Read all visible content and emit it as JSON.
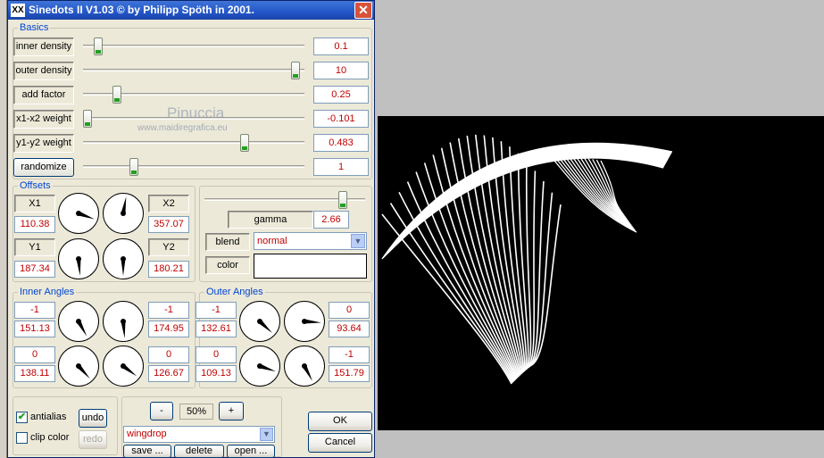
{
  "title": "Sinedots II V1.03 © by Philipp Spöth in 2001.",
  "title_icon": "XX",
  "close_glyph": "✕",
  "watermark": {
    "line1": "Pinuccia",
    "line2": "www.maidiregrafica.eu"
  },
  "basics": {
    "title": "Basics",
    "rows": [
      {
        "label": "inner density",
        "value": "0.1",
        "slider": 0.05
      },
      {
        "label": "outer density",
        "value": "10",
        "slider": 0.98
      },
      {
        "label": "add factor",
        "value": "0.25",
        "slider": 0.14
      },
      {
        "label": "x1-x2 weight",
        "value": "-0.101",
        "slider": 0.0
      },
      {
        "label": "y1-y2 weight",
        "value": "0.483",
        "slider": 0.74
      },
      {
        "label": "randomize",
        "value": "1",
        "slider": 0.22
      }
    ]
  },
  "offsets": {
    "title": "Offsets",
    "x1": {
      "label": "X1",
      "value": "110.38"
    },
    "x2": {
      "label": "X2",
      "value": "357.07"
    },
    "y1": {
      "label": "Y1",
      "value": "187.34"
    },
    "y2": {
      "label": "Y2",
      "value": "180.21"
    },
    "dial_angles": [
      110,
      10,
      175,
      180
    ]
  },
  "gamma": {
    "label": "gamma",
    "value": "2.66",
    "slider": 0.88
  },
  "blend": {
    "label": "blend",
    "value": "normal",
    "color": "#c00000"
  },
  "color": {
    "label": "color",
    "swatch": "#ffffff"
  },
  "inner_angles": {
    "title": "Inner Angles",
    "cells": [
      {
        "top": "-1",
        "bottom": "151.13"
      },
      {
        "top": "-1",
        "bottom": "174.95"
      },
      {
        "top": "0",
        "bottom": "138.11"
      },
      {
        "top": "0",
        "bottom": "126.67"
      }
    ],
    "dial_angles": [
      151,
      175,
      138,
      127
    ]
  },
  "outer_angles": {
    "title": "Outer Angles",
    "cells": [
      {
        "top": "-1",
        "bottom": "132.61"
      },
      {
        "top": "0",
        "bottom": "93.64"
      },
      {
        "top": "0",
        "bottom": "109.13"
      },
      {
        "top": "-1",
        "bottom": "151.79"
      }
    ],
    "dial_angles": [
      133,
      94,
      109,
      152
    ]
  },
  "options": {
    "antialias": {
      "label": "antialias",
      "checked": true
    },
    "clip_color": {
      "label": "clip color",
      "checked": false
    },
    "undo": "undo",
    "redo": "redo"
  },
  "presets": {
    "minus": "-",
    "zoom": "50%",
    "plus": "+",
    "selected": "wingdrop",
    "save": "save ...",
    "delete": "delete",
    "open": "open ..."
  },
  "ok": "OK",
  "cancel": "Cancel",
  "colors": {
    "accent": "#0046d5",
    "value_text": "#c00000",
    "preview_bg": "#000000",
    "curve": "#ffffff"
  }
}
